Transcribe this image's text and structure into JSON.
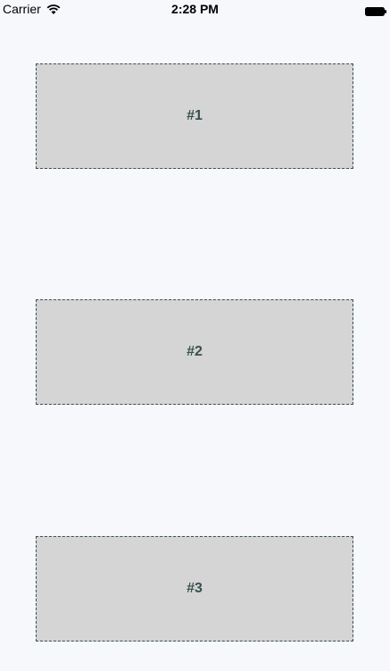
{
  "status_bar": {
    "carrier": "Carrier",
    "time": "2:28 PM",
    "wifi_icon": "wifi-icon",
    "battery_icon": "battery-icon"
  },
  "boxes": [
    {
      "label": "#1"
    },
    {
      "label": "#2"
    },
    {
      "label": "#3"
    }
  ],
  "colors": {
    "background": "#f7f8fc",
    "box_fill": "#d5d5d5",
    "box_border": "#37504f",
    "label_text": "#37504f"
  }
}
